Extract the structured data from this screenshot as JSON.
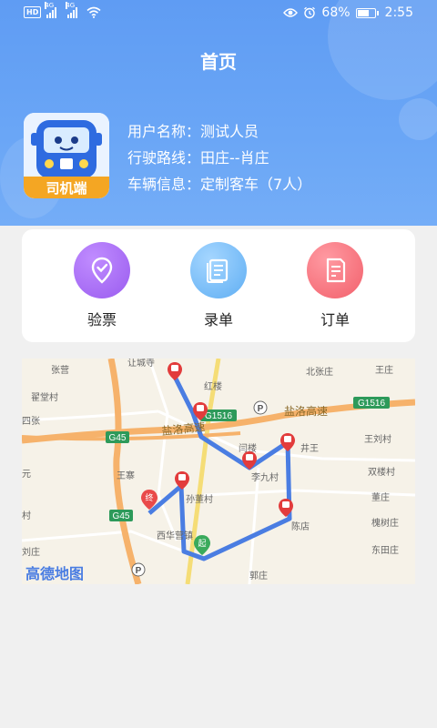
{
  "statusbar": {
    "hd": "HD",
    "sim1": "4G",
    "sim2": "4G",
    "battery_pct": "68%",
    "battery_level": 0.68,
    "time": "2:55"
  },
  "header": {
    "title": "首页"
  },
  "app_icon": {
    "badge": "司机端"
  },
  "user": {
    "name_label": "用户名称：",
    "name_value": "测试人员",
    "route_label": "行驶路线：",
    "route_value": "田庄--肖庄",
    "vehicle_label": "车辆信息：",
    "vehicle_value": "定制客车（7人）"
  },
  "actions": [
    {
      "label": "验票",
      "icon": "ticket-check-icon",
      "color": "#a66af0"
    },
    {
      "label": "录单",
      "icon": "record-book-icon",
      "color": "#6cb5f5"
    },
    {
      "label": "订单",
      "icon": "order-doc-icon",
      "color": "#f6707a"
    }
  ],
  "map": {
    "logo": "高德地图",
    "start_marker": "起",
    "end_marker": "终",
    "road_labels": [
      "G1516",
      "G1516",
      "G45",
      "G45",
      "盐洛高速",
      "盐洛高速"
    ],
    "places": [
      "张营",
      "北张庄",
      "王庄",
      "翟堂村",
      "四张",
      "红楼",
      "王刘村",
      "闫楼",
      "井王",
      "王寨",
      "李九村",
      "双楼村",
      "孙董村",
      "董庄",
      "村",
      "陈店",
      "槐树庄",
      "西华营镇",
      "刘庄",
      "东田庄",
      "郭庄",
      "元",
      "让城寺"
    ]
  }
}
